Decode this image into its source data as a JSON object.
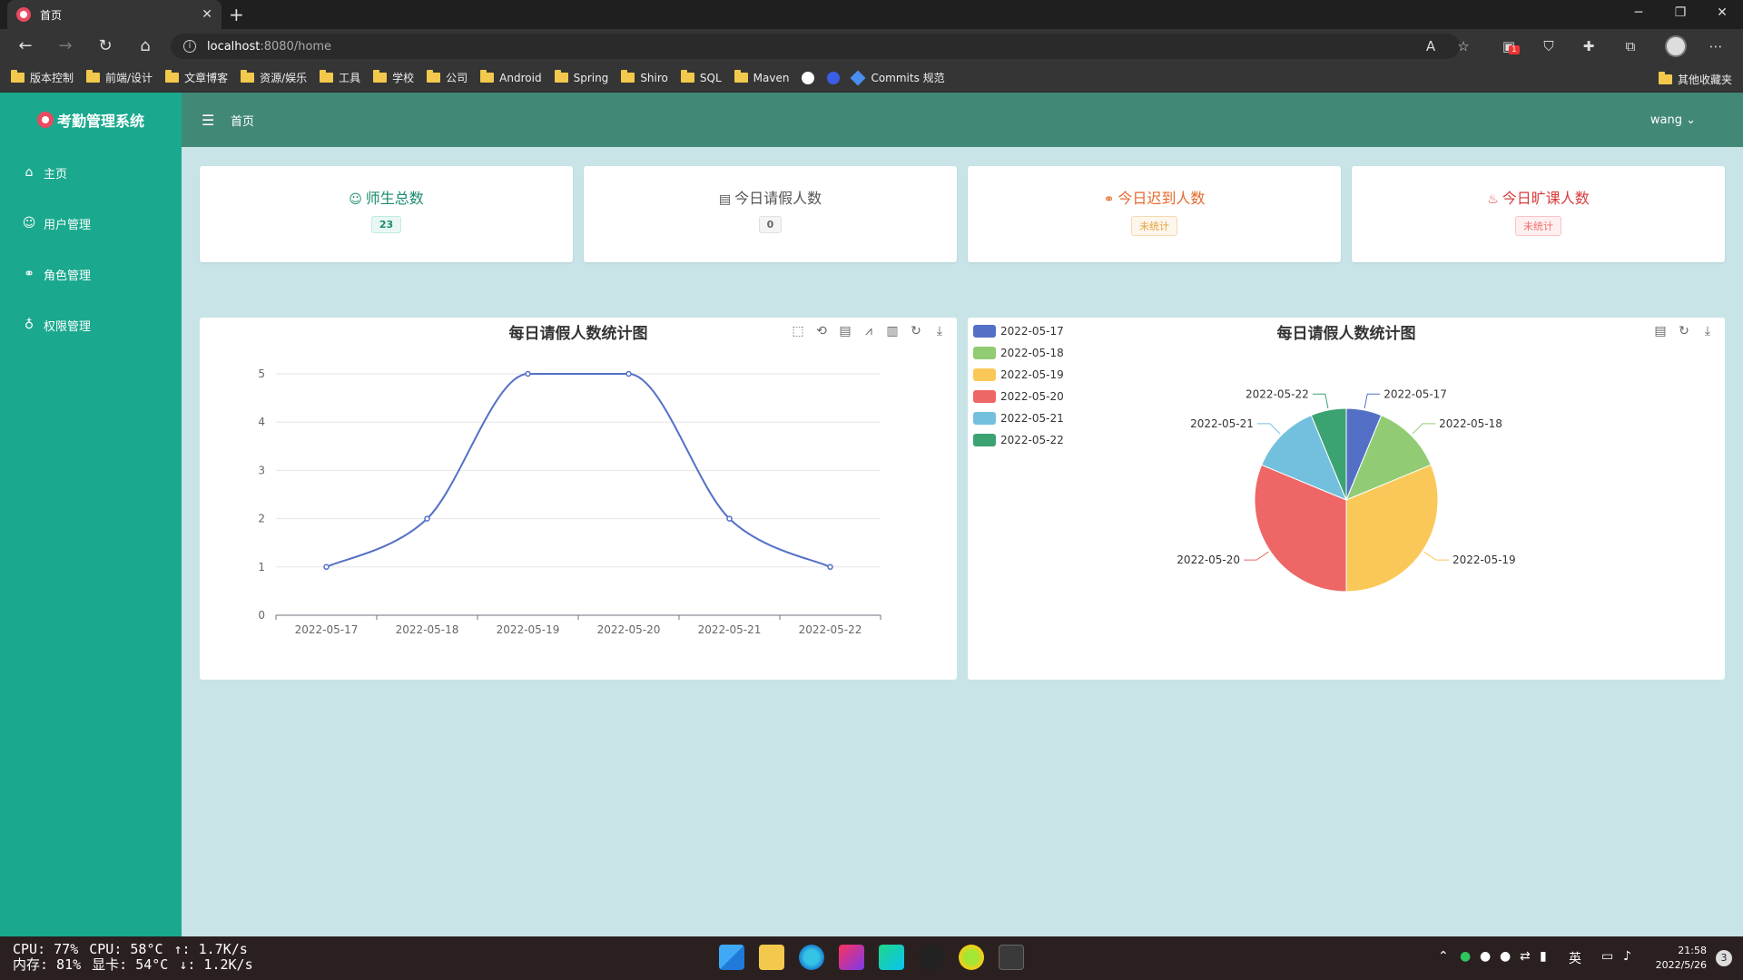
{
  "browser": {
    "tab_title": "首页",
    "url_host": "localhost",
    "url_rest": ":8080/home",
    "bookmarks": [
      "版本控制",
      "前端/设计",
      "文章博客",
      "资源/娱乐",
      "工具",
      "学校",
      "公司",
      "Android",
      "Spring",
      "Shiro",
      "SQL",
      "Maven"
    ],
    "bookmark_commits": "Commits 规范",
    "bookmark_other": "其他收藏夹",
    "extension_badge": "1"
  },
  "app": {
    "brand": "考勤管理系统",
    "breadcrumb": "首页",
    "username": "wang",
    "menu": [
      {
        "label": "主页",
        "icon": "home-icon"
      },
      {
        "label": "用户管理",
        "icon": "user-icon"
      },
      {
        "label": "角色管理",
        "icon": "link-icon"
      },
      {
        "label": "权限管理",
        "icon": "lock-icon"
      }
    ],
    "stats": [
      {
        "title": "师生总数",
        "value": "23",
        "icon": "user-icon",
        "color": "#1a8a6f"
      },
      {
        "title": "今日请假人数",
        "value": "0",
        "icon": "document-icon",
        "color": "#555555"
      },
      {
        "title": "今日迟到人数",
        "value": "未统计",
        "icon": "link-icon",
        "color": "#e6692e"
      },
      {
        "title": "今日旷课人数",
        "value": "未统计",
        "icon": "basket-icon",
        "color": "#d93b3b"
      }
    ]
  },
  "chart_data": [
    {
      "type": "line",
      "title": "每日请假人数统计图",
      "categories": [
        "2022-05-17",
        "2022-05-18",
        "2022-05-19",
        "2022-05-20",
        "2022-05-21",
        "2022-05-22"
      ],
      "values": [
        1,
        2,
        5,
        5,
        2,
        1
      ],
      "ylim": [
        0,
        5
      ],
      "yticks": [
        0,
        1,
        2,
        3,
        4,
        5
      ],
      "smooth": true,
      "color": "#5470c6"
    },
    {
      "type": "pie",
      "title": "每日请假人数统计图",
      "legend_position": "top-left",
      "slices": [
        {
          "label": "2022-05-17",
          "value": 1,
          "color": "#5470c6"
        },
        {
          "label": "2022-05-18",
          "value": 2,
          "color": "#91cc75"
        },
        {
          "label": "2022-05-19",
          "value": 5,
          "color": "#fac858"
        },
        {
          "label": "2022-05-20",
          "value": 5,
          "color": "#ee6666"
        },
        {
          "label": "2022-05-21",
          "value": 2,
          "color": "#73c0de"
        },
        {
          "label": "2022-05-22",
          "value": 1,
          "color": "#3ba272"
        }
      ]
    }
  ],
  "taskbar": {
    "cpu_usage": "CPU: 77%",
    "cpu_temp": "CPU: 58°C",
    "upload": "↑: 1.7K/s",
    "mem_usage": "内存: 81%",
    "gpu_temp": "显卡: 54°C",
    "download": "↓: 1.2K/s",
    "ime": "英",
    "time": "21:58",
    "date": "2022/5/26",
    "notifications": "3"
  }
}
